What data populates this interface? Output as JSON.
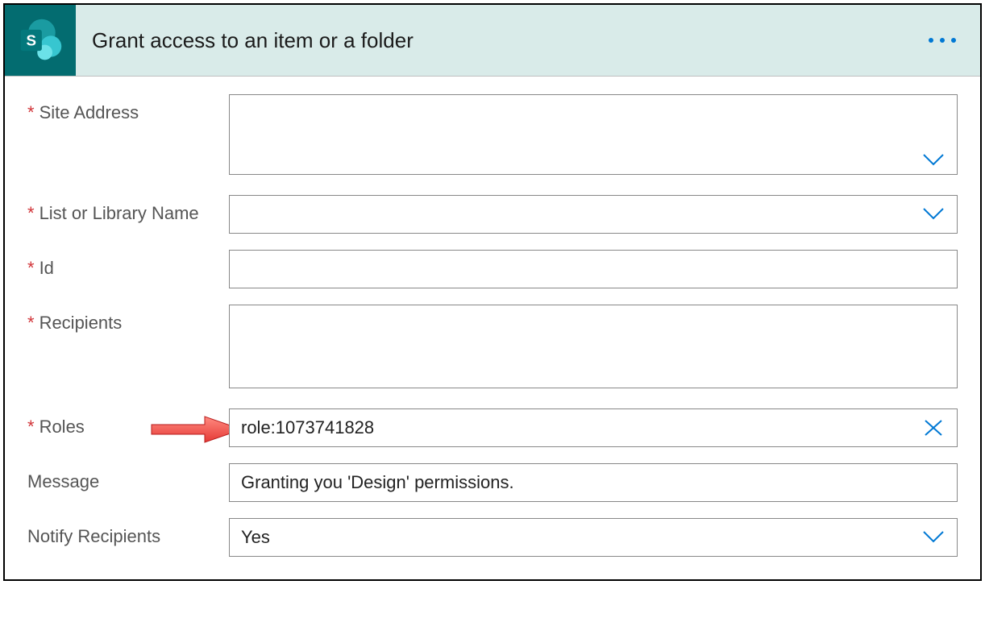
{
  "header": {
    "title": "Grant access to an item or a folder"
  },
  "fields": {
    "siteAddress": {
      "label": "Site Address",
      "required": true,
      "value": "",
      "type": "dropdown-tall"
    },
    "listOrLibrary": {
      "label": "List or Library Name",
      "required": true,
      "value": "",
      "type": "dropdown"
    },
    "id": {
      "label": "Id",
      "required": true,
      "value": "",
      "type": "text"
    },
    "recipients": {
      "label": "Recipients",
      "required": true,
      "value": "",
      "type": "textarea"
    },
    "roles": {
      "label": "Roles",
      "required": true,
      "value": "role:1073741828",
      "type": "clearable",
      "annotated": true
    },
    "message": {
      "label": "Message",
      "required": false,
      "value": "Granting you 'Design' permissions.",
      "type": "text"
    },
    "notify": {
      "label": "Notify Recipients",
      "required": false,
      "value": "Yes",
      "type": "dropdown"
    }
  }
}
